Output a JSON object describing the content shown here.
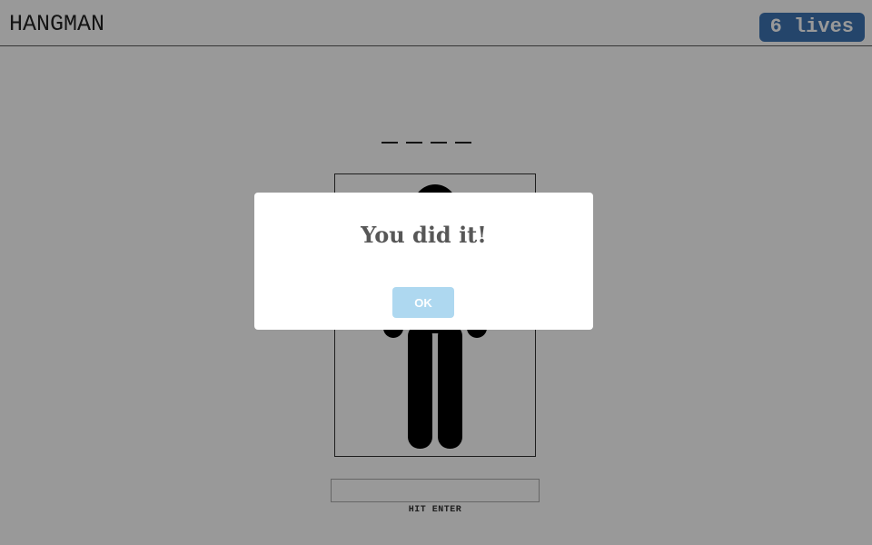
{
  "header": {
    "title": "HANGMAN",
    "lives": "6 lives"
  },
  "game": {
    "word_slots": [
      "_",
      "_",
      "_",
      "_"
    ],
    "hint": "HIT ENTER",
    "guess_value": ""
  },
  "modal": {
    "title": "You did it!",
    "ok_label": "OK"
  },
  "colors": {
    "lives_badge": "#3d73b3",
    "ok_button": "#aed8f0",
    "overlay": "rgba(0,0,0,0.4)"
  },
  "icons": {
    "figure": "hangman-figure-icon"
  }
}
